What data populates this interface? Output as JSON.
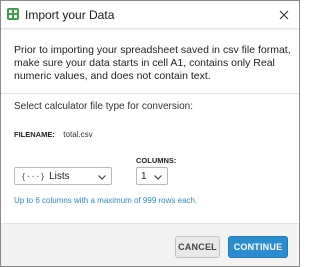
{
  "window": {
    "title": "Import your Data",
    "app_icon": "grid-app-icon",
    "close_icon": "close-icon"
  },
  "intro_text": "Prior to importing your spreadsheet saved in csv file format, make sure your data starts in cell A1, contains only Real numeric values, and does not contain text.",
  "select_label": "Select calculator file type for conversion:",
  "filename": {
    "label": "FILENAME:",
    "value": "total.csv"
  },
  "type_dropdown": {
    "icon_text": "{···}",
    "selected": "Lists"
  },
  "columns": {
    "label": "COLUMNS:",
    "selected": "1"
  },
  "info_text": "Up to 6 columns with a maximum of 999 rows each.",
  "buttons": {
    "cancel": "CANCEL",
    "continue": "CONTINUE"
  },
  "colors": {
    "accent": "#2a8dd0",
    "footer": "#f3f3f3"
  }
}
